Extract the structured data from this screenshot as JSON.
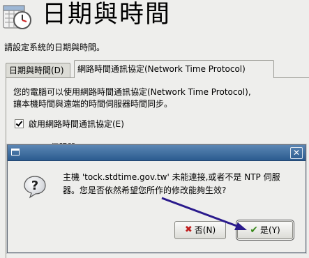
{
  "header": {
    "title": "日期與時間",
    "subtitle": "請設定系統的日期與時間。",
    "icon": "calendar-clock-icon"
  },
  "tabs": [
    {
      "label": "日期與時間(D)",
      "active": false
    },
    {
      "label": "網路時間通訊協定(Network Time Protocol)",
      "active": true
    }
  ],
  "ntp_panel": {
    "description_line1": "您的電腦可以使用網路時間通訊協定(Network Time Protocol),",
    "description_line2": "讓本機時間與遠端的時間伺服器時間同步。",
    "enable_checkbox_label": "啟用網路時間通訊協定(E)",
    "enable_checked": true,
    "servers_label_partial": "NTP 伺服器"
  },
  "dialog": {
    "icon": "question-icon",
    "message": "主機 'tock.stdtime.gov.tw' 未能連接,或者不是 NTP 伺服器。您是否依然希望您所作的修改能夠生效?",
    "no_label": "否(N)",
    "yes_label": "是(Y)",
    "close_icon": "close-icon"
  },
  "annotation": {
    "color": "#2a1a8c",
    "icon": "arrow-annotation"
  }
}
